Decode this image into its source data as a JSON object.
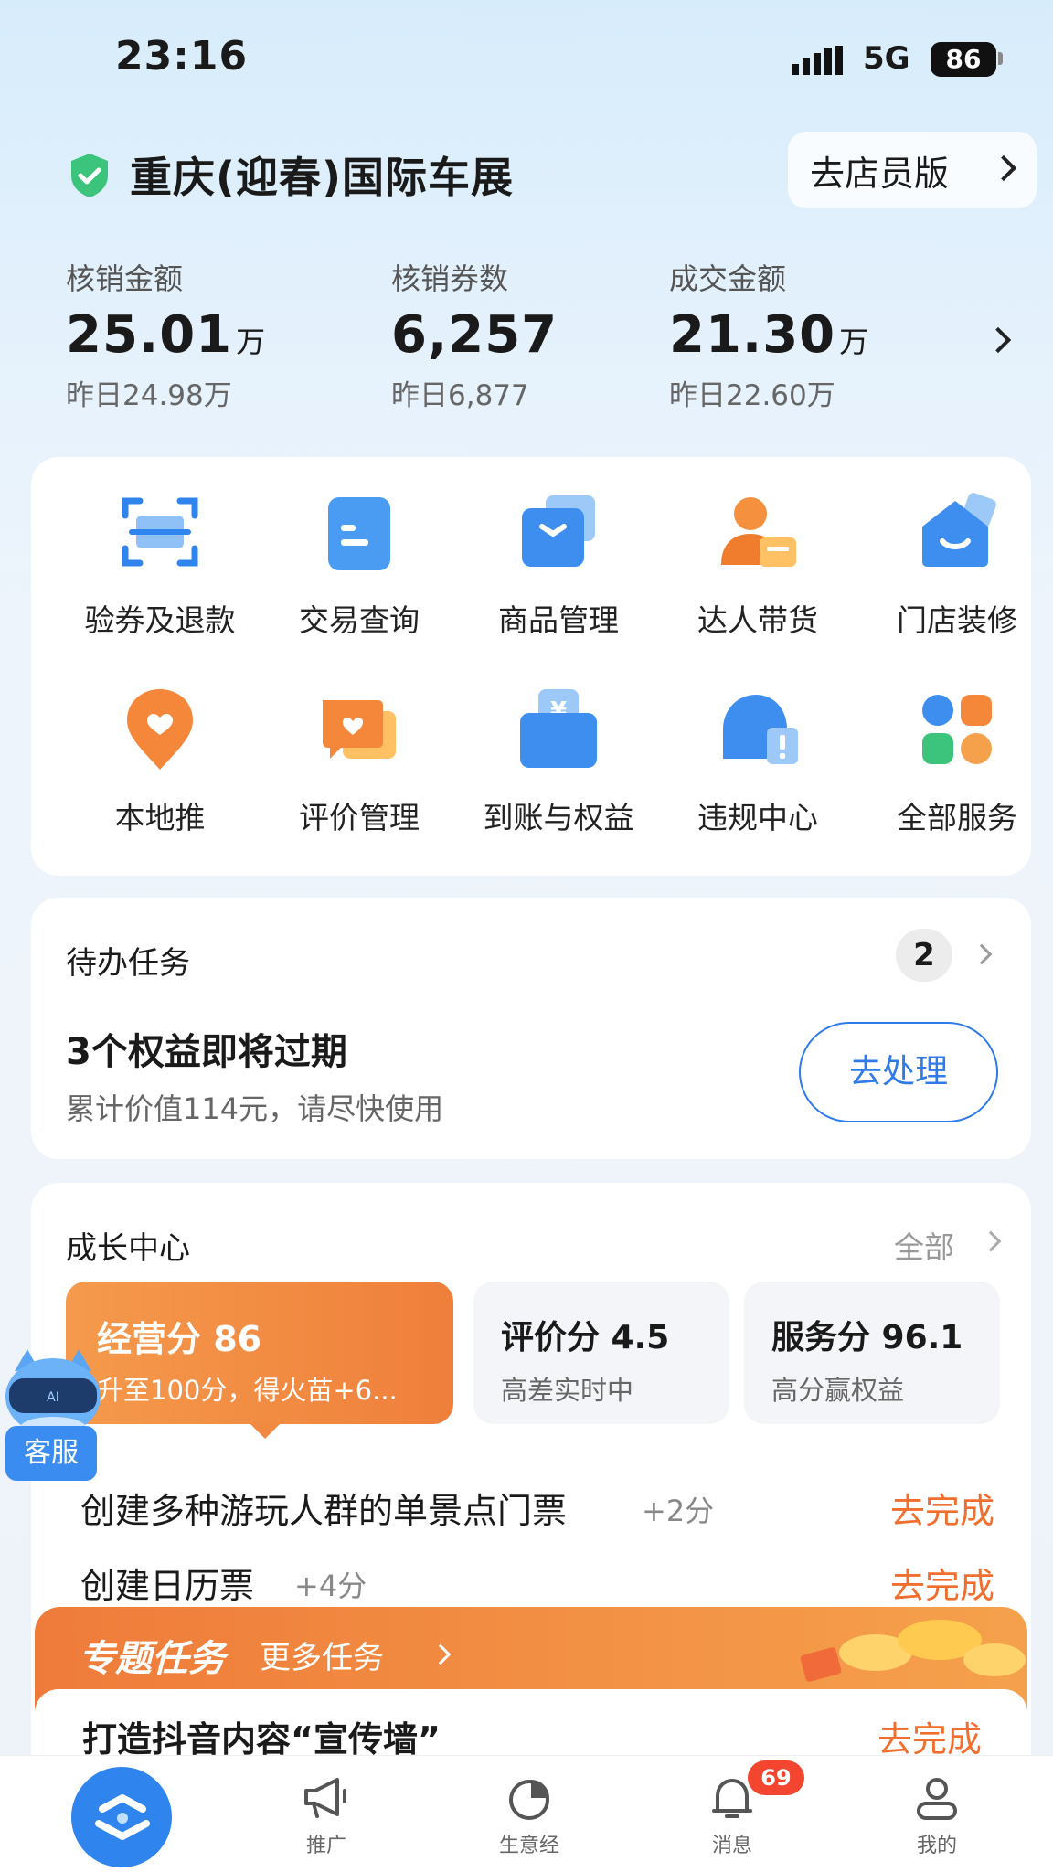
{
  "status_bar": {
    "time": "23:16",
    "network": "5G",
    "battery": "86"
  },
  "header": {
    "store_name": "重庆(迎春)国际车展",
    "staff_button": "去店员版"
  },
  "stats": [
    {
      "label": "核销金额",
      "value": "25.01",
      "unit": "万",
      "sub": "昨日24.98万"
    },
    {
      "label": "核销券数",
      "value": "6,257",
      "unit": "",
      "sub": "昨日6,877"
    },
    {
      "label": "成交金额",
      "value": "21.30",
      "unit": "万",
      "sub": "昨日22.60万"
    }
  ],
  "services": [
    {
      "label": "验券及退款",
      "icon": "scan-icon"
    },
    {
      "label": "交易查询",
      "icon": "clipboard-icon"
    },
    {
      "label": "商品管理",
      "icon": "box-icon"
    },
    {
      "label": "达人带货",
      "icon": "influencer-icon"
    },
    {
      "label": "门店装修",
      "icon": "shop-icon"
    },
    {
      "label": "本地推",
      "icon": "location-icon"
    },
    {
      "label": "评价管理",
      "icon": "review-icon"
    },
    {
      "label": "到账与权益",
      "icon": "wallet-icon"
    },
    {
      "label": "违规中心",
      "icon": "alert-icon"
    },
    {
      "label": "全部服务",
      "icon": "apps-icon"
    }
  ],
  "todo": {
    "title": "待办任务",
    "count": "2",
    "main": "3个权益即将过期",
    "sub": "累计价值114元，请尽快使用",
    "button": "去处理"
  },
  "growth": {
    "title": "成长中心",
    "all": "全部",
    "scores": [
      {
        "title": "经营分 86",
        "sub": "升至100分，得火苗+6..."
      },
      {
        "title": "评价分 4.5",
        "sub": "高差实时中"
      },
      {
        "title": "服务分 96.1",
        "sub": "高分赢权益"
      }
    ],
    "tasks": [
      {
        "text": "创建多种游玩人群的单景点门票",
        "points": "+2分",
        "action": "去完成"
      },
      {
        "text": "创建日历票",
        "points": "+4分",
        "action": "去完成"
      }
    ]
  },
  "special": {
    "title": "专题任务",
    "more": "更多任务",
    "task": "打造抖音内容“宣传墙”",
    "action": "去完成"
  },
  "assistant": {
    "label": "客服"
  },
  "tabbar": {
    "items": [
      {
        "label": "",
        "icon": "home-icon"
      },
      {
        "label": "推广",
        "icon": "megaphone-icon"
      },
      {
        "label": "生意经",
        "icon": "pie-chart-icon"
      },
      {
        "label": "消息",
        "icon": "bell-icon"
      },
      {
        "label": "我的",
        "icon": "profile-icon"
      }
    ],
    "message_badge": "69"
  },
  "colors": {
    "accent": "#2f84ee",
    "orange": "#f26e2e",
    "shield": "#3cc47c"
  }
}
